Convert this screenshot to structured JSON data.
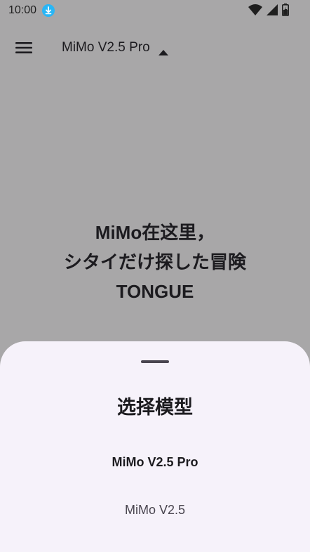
{
  "status_bar": {
    "time": "10:00",
    "icons": [
      "download-icon",
      "wifi-icon",
      "signal-icon",
      "battery-charging-icon"
    ]
  },
  "app_bar": {
    "menu_icon": "menu-icon",
    "model_title": "MiMo V2.5 Pro",
    "caret_icon": "caret-up-icon"
  },
  "welcome": {
    "line1": "MiMo在这里，",
    "line2": "シタイだけ探した冒険",
    "line3": "TONGUE"
  },
  "sheet": {
    "title": "选择模型",
    "options": [
      {
        "label": "MiMo V2.5 Pro",
        "selected": true
      },
      {
        "label": "MiMo V2.5",
        "selected": false
      }
    ]
  },
  "colors": {
    "scrim_background": "#a8a7a8",
    "sheet_background": "#f6f2fa",
    "text_primary": "#1c1b1f",
    "text_secondary": "#49454f",
    "download_badge": "#29b6f6"
  }
}
